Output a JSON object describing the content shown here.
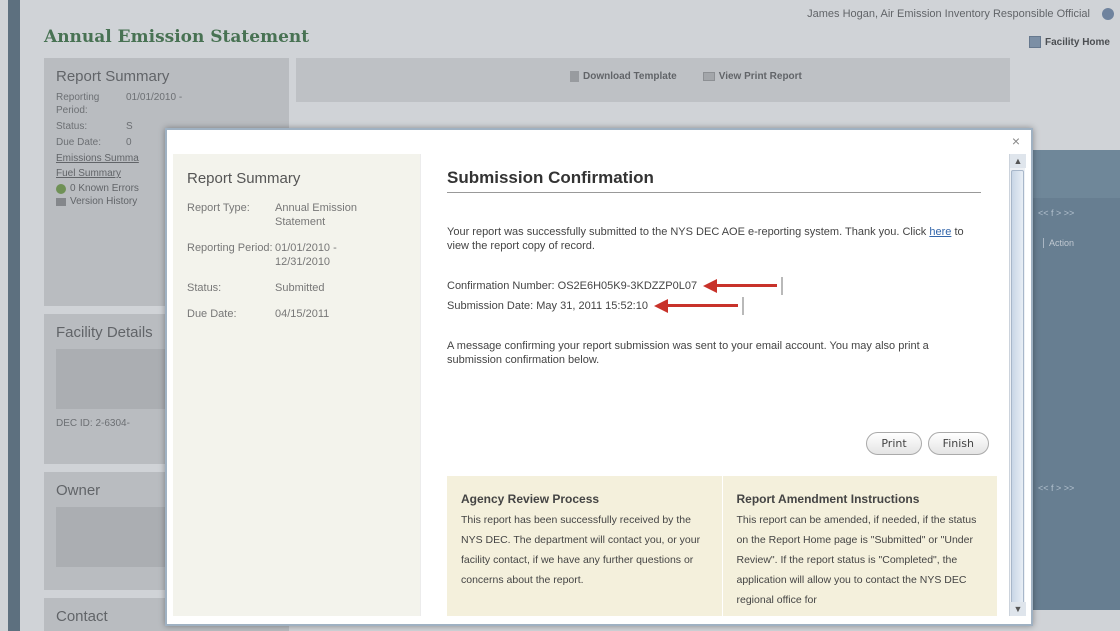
{
  "header": {
    "title": "Annual Emission Statement",
    "user": "James Hogan, Air Emission Inventory Responsible Official",
    "facility_home": "Facility Home"
  },
  "toolbar": {
    "download_template": "Download Template",
    "view_print_report": "View Print Report"
  },
  "bg_sidebar": {
    "report_summary": "Report Summary",
    "reporting_period_label": "Reporting Period:",
    "reporting_period_value": "01/01/2010 -",
    "status_label": "Status:",
    "status_value": "S",
    "due_date_label": "Due Date:",
    "due_date_value": "0",
    "emissions_summary": "Emissions Summa",
    "fuel_summary": "Fuel Summary",
    "known_errors": "0 Known Errors",
    "version_history": "Version History",
    "facility_details": "Facility Details",
    "dec_id": "DEC ID: 2-6304-",
    "owner": "Owner",
    "contact": "Contact"
  },
  "grid": {
    "pager": "<< f > >>",
    "action": "Action"
  },
  "modal": {
    "close": "×",
    "sidebar": {
      "heading": "Report Summary",
      "rows": [
        {
          "k": "Report Type:",
          "v": "Annual Emission Statement"
        },
        {
          "k": "Reporting Period:",
          "v": "01/01/2010 - 12/31/2010"
        },
        {
          "k": "Status:",
          "v": "Submitted"
        },
        {
          "k": "Due Date:",
          "v": "04/15/2011"
        }
      ]
    },
    "title": "Submission Confirmation",
    "success_text": "Your report was successfully submitted to the NYS DEC AOE e-reporting system. Thank you. Click",
    "here_link": "here",
    "success_text2": "to view the report copy of record.",
    "confirmation_label": "Confirmation Number: OS2E6H05K9-3KDZZP0L07",
    "submission_date": "Submission Date: May 31, 2011 15:52:10",
    "email_text": "A message confirming your report submission was sent to your email account. You may also print a submission confirmation below.",
    "print_button": "Print",
    "finish_button": "Finish",
    "agency_title": "Agency Review Process",
    "agency_text": "This report has been successfully received by the NYS DEC. The department will contact you, or your facility contact, if we have any further questions or concerns about the report.",
    "amend_title": "Report Amendment Instructions",
    "amend_text": "This report can be amended, if needed, if the status on the Report Home page is \"Submitted\" or \"Under Review\". If the report status is \"Completed\", the application will allow you to contact the NYS DEC regional office for"
  }
}
